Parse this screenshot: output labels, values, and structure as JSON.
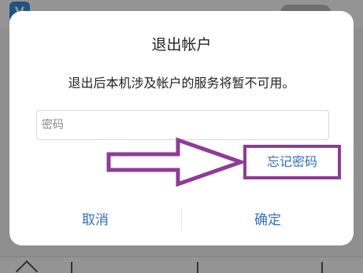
{
  "dialog": {
    "title": "退出帐户",
    "message": "退出后本机涉及帐户的服务将暂不可用。",
    "password_placeholder": "密码",
    "forgot_label": "忘记密码",
    "cancel_label": "取消",
    "confirm_label": "确定"
  },
  "annotation": {
    "arrow_color": "#8e3c97",
    "box_color": "#8e3c97"
  },
  "colors": {
    "link_blue": "#2f6fc6",
    "dialog_bg": "#ffffff"
  },
  "icons": [
    "app-logo-icon",
    "annotation-arrow",
    "nav-icon"
  ]
}
